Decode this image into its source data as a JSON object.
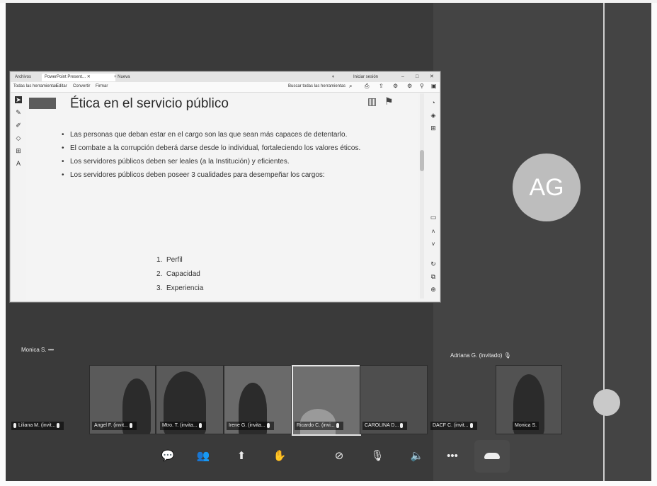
{
  "browser": {
    "tab_files": "Archivos",
    "tab_active": "PowerPoint Present...",
    "tab_new": "+ Nueva",
    "signin": "Iniciar sesión",
    "toolbar_items": [
      "Todas las herramientas",
      "Editar",
      "Convertir",
      "Firmar"
    ],
    "toolbar_search": "Buscar todas las herramientas"
  },
  "slide": {
    "title": "Ética en el servicio público",
    "bullets": [
      "Las personas que deban estar en el cargo son las que sean más capaces de detentarlo.",
      "El combate a la corrupción deberá darse desde lo individual, fortaleciendo los valores éticos.",
      "Los servidores públicos deben ser leales (a la Institución) y eficientes.",
      "Los servidores públicos deben poseer 3 cualidades para desempeñar los cargos:"
    ],
    "numbered": [
      {
        "n": "1.",
        "text": "Perfil"
      },
      {
        "n": "2.",
        "text": "Capacidad"
      },
      {
        "n": "3.",
        "text": "Experiencia"
      }
    ]
  },
  "call": {
    "presenter_label": "Monica S.",
    "more_glyph": "•••",
    "guest_label": "Adriana G. (invitado)",
    "avatar_initials": "AG",
    "participants": [
      "Liliana M. (invit...",
      "Angel F. (invit...",
      "Mtro. T. (invita...",
      "Irene G. (invita...",
      "Ricardo C. (invi...",
      "CAROLINA D...",
      "DACF C. (invit...",
      "Monica S."
    ]
  },
  "colors": {
    "background": "#3a3a3a",
    "avatar": "#bdbdbd",
    "slide_bg": "#f4f4f4"
  }
}
